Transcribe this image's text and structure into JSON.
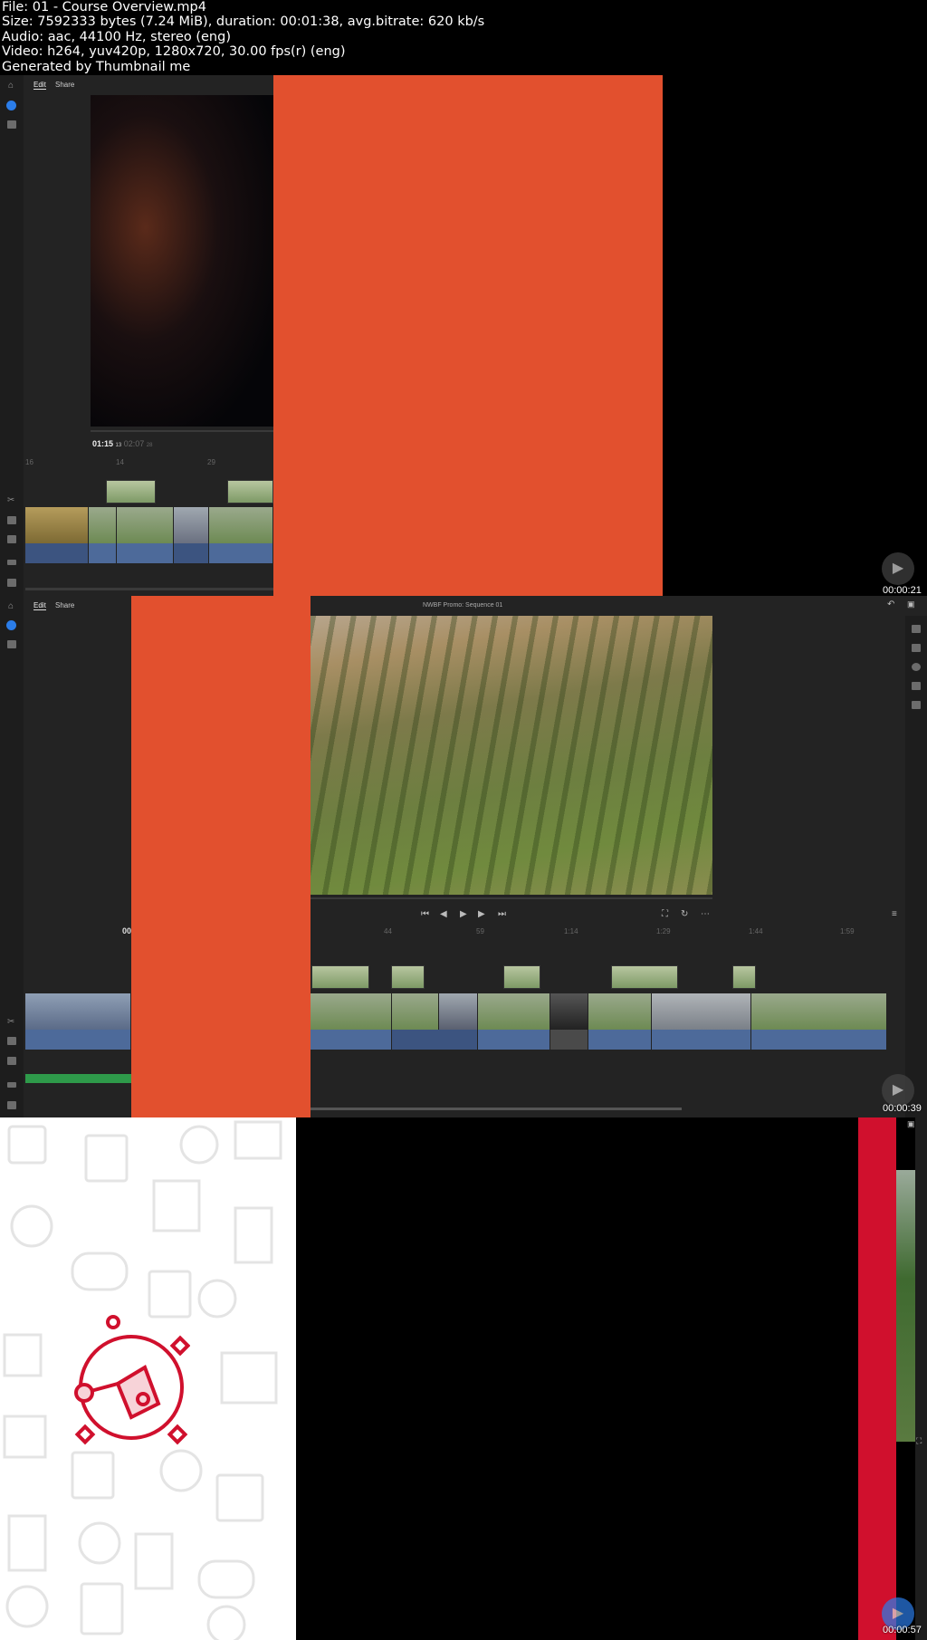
{
  "info": {
    "lines": [
      "File: 01 - Course Overview.mp4",
      "Size: 7592333 bytes (7.24 MiB), duration: 00:01:38, avg.bitrate: 620 kb/s",
      "Audio: aac, 44100 Hz, stereo (eng)",
      "Video: h264, yuv420p, 1280x720, 30.00 fps(r) (eng)",
      "Generated by Thumbnail me"
    ]
  },
  "frames": [
    {
      "timestamp": "00:00:21",
      "tabs": [
        "Edit",
        "Share"
      ],
      "timecode_current": "01:15",
      "timecode_current_frames": "13",
      "timecode_total": "02:07",
      "timecode_total_frames": "28",
      "ruler": [
        "16",
        "14",
        "29"
      ]
    },
    {
      "timestamp": "00:00:39",
      "tabs": [
        "Edit",
        "Share"
      ],
      "sequence_title": "NWBF Promo: Sequence 01",
      "timecode_partial": "00",
      "ruler": [
        "44",
        "59",
        "1:14",
        "1:29",
        "1:44",
        "1:59"
      ]
    },
    {
      "timestamp": "00:00:57"
    }
  ],
  "colors": {
    "orange": "#e2502e",
    "red": "#d0102d",
    "app_bg": "#232323",
    "accent_blue": "#2b7de9"
  }
}
